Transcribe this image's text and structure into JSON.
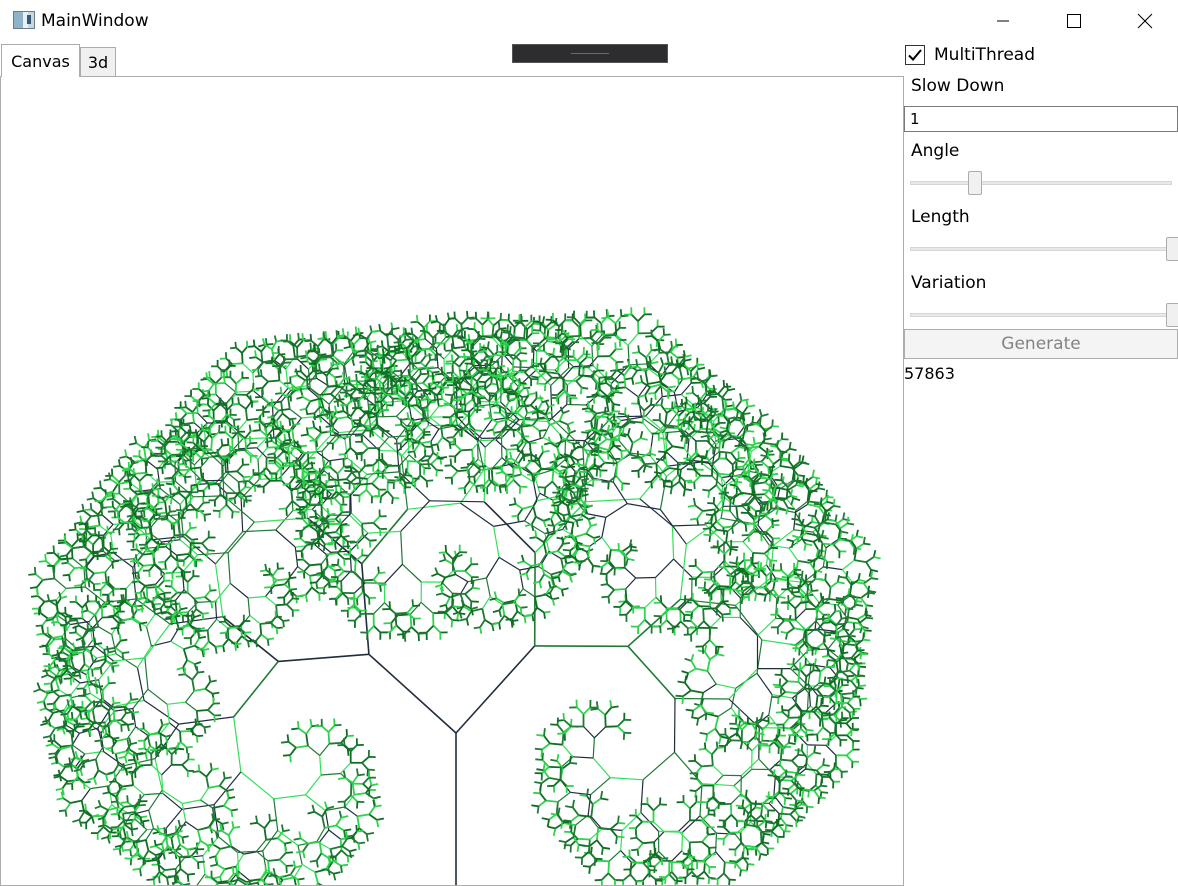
{
  "window": {
    "title": "MainWindow"
  },
  "tabs": [
    {
      "label": "Canvas",
      "selected": true
    },
    {
      "label": "3d",
      "selected": false
    }
  ],
  "panel": {
    "multithread": {
      "label": "MultiThread",
      "checked": true
    },
    "slow_down": {
      "label": "Slow Down",
      "value": "1"
    },
    "angle": {
      "label": "Angle",
      "level": 0.14
    },
    "length": {
      "label": "Length",
      "level": 1.0
    },
    "variation": {
      "label": "Variation",
      "level": 1.0
    },
    "generate_label": "Generate",
    "generate_enabled": false,
    "count": "57863"
  },
  "colors": {
    "branch_dark": "#1f2d3d",
    "branch_mid": "#1e7a34",
    "branch_light": "#34e05a",
    "leaf_dark": "#0f6e22",
    "leaf_light": "#2fd24c"
  },
  "tree": {
    "depth": 12,
    "spread_angle_deg": 45,
    "length_ratio": 0.78
  }
}
